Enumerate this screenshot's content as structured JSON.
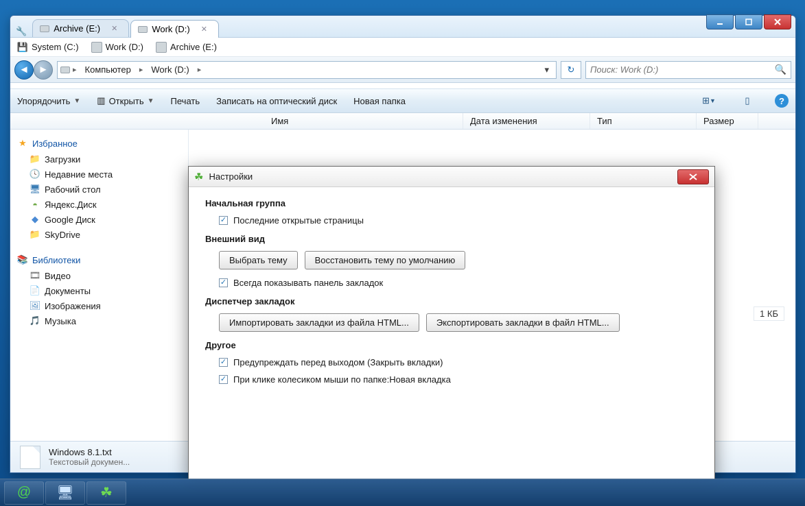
{
  "window": {
    "tabs": [
      {
        "label": "Archive (E:)",
        "active": false
      },
      {
        "label": "Work (D:)",
        "active": true
      }
    ],
    "controls": {
      "min": "–",
      "max": "▢",
      "close": "✕"
    }
  },
  "bookmarks": [
    {
      "label": "System (C:)",
      "icon": "drive"
    },
    {
      "label": "Work (D:)",
      "icon": "drive"
    },
    {
      "label": "Archive (E:)",
      "icon": "drive"
    }
  ],
  "nav": {
    "crumbs": [
      "Компьютер",
      "Work (D:)"
    ],
    "search_placeholder": "Поиск: Work (D:)"
  },
  "toolbar": {
    "organize": "Упорядочить",
    "open": "Открыть",
    "print": "Печать",
    "burn": "Записать на оптический диск",
    "newfolder": "Новая папка"
  },
  "columns": {
    "name": "Имя",
    "date": "Дата изменения",
    "type": "Тип",
    "size": "Размер"
  },
  "sidebar": {
    "favorites": {
      "label": "Избранное",
      "items": [
        {
          "label": "Загрузки",
          "icon": "fold"
        },
        {
          "label": "Недавние места",
          "icon": "recent"
        },
        {
          "label": "Рабочий стол",
          "icon": "desk"
        },
        {
          "label": "Яндекс.Диск",
          "icon": "yad"
        },
        {
          "label": "Google Диск",
          "icon": "gd"
        },
        {
          "label": "SkyDrive",
          "icon": "fold"
        }
      ]
    },
    "libraries": {
      "label": "Библиотеки",
      "items": [
        {
          "label": "Видео",
          "icon": "vid"
        },
        {
          "label": "Документы",
          "icon": "doc"
        },
        {
          "label": "Изображения",
          "icon": "img"
        },
        {
          "label": "Музыка",
          "icon": "mus"
        }
      ]
    }
  },
  "content": {
    "ghost_size": "1 КБ"
  },
  "statusbar": {
    "filename": "Windows 8.1.txt",
    "filetype": "Текстовый докумен..."
  },
  "dialog": {
    "title": "Настройки",
    "sections": {
      "startup": {
        "heading": "Начальная группа",
        "chk_last_pages": "Последние открытые страницы"
      },
      "appearance": {
        "heading": "Внешний вид",
        "btn_theme": "Выбрать тему",
        "btn_reset_theme": "Восстановить тему по умолчанию",
        "chk_show_bm": "Всегда показывать панель закладок"
      },
      "bookmarks": {
        "heading": "Диспетчер закладок",
        "btn_import": "Импортировать закладки из файла HTML...",
        "btn_export": "Экспортировать закладки в файл HTML..."
      },
      "other": {
        "heading": "Другое",
        "chk_warn": "Предупреждать перед выходом (Закрыть вкладки)",
        "chk_wheel": "При клике колесиком мыши по папке:Новая вкладка"
      }
    }
  },
  "taskbar": {
    "items": [
      "at",
      "monitor",
      "clover"
    ]
  }
}
